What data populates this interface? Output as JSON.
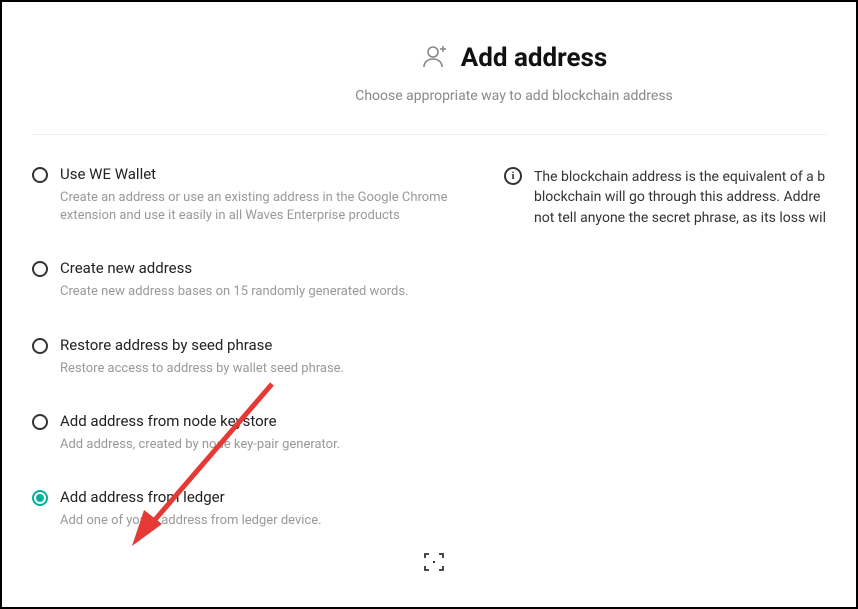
{
  "header": {
    "title": "Add address",
    "subtitle": "Choose appropriate way to add blockchain address"
  },
  "options": [
    {
      "title": "Use WE Wallet",
      "desc": "Create an address or use an existing address in the Google Chrome extension and use it easily in all Waves Enterprise products",
      "selected": false
    },
    {
      "title": "Create new address",
      "desc": "Create new address bases on 15 randomly generated words.",
      "selected": false
    },
    {
      "title": "Restore address by seed phrase",
      "desc": "Restore access to address by wallet seed phrase.",
      "selected": false
    },
    {
      "title": "Add address from node keystore",
      "desc": "Add address, created by node key-pair generator.",
      "selected": false
    },
    {
      "title": "Add address from ledger",
      "desc": "Add one of yours address from ledger device.",
      "selected": true
    }
  ],
  "info": {
    "line1": "The blockchain address is the equivalent of a b",
    "line2": "blockchain will go through this address. Addre",
    "line3": "not tell anyone the secret phrase, as its loss wil"
  }
}
